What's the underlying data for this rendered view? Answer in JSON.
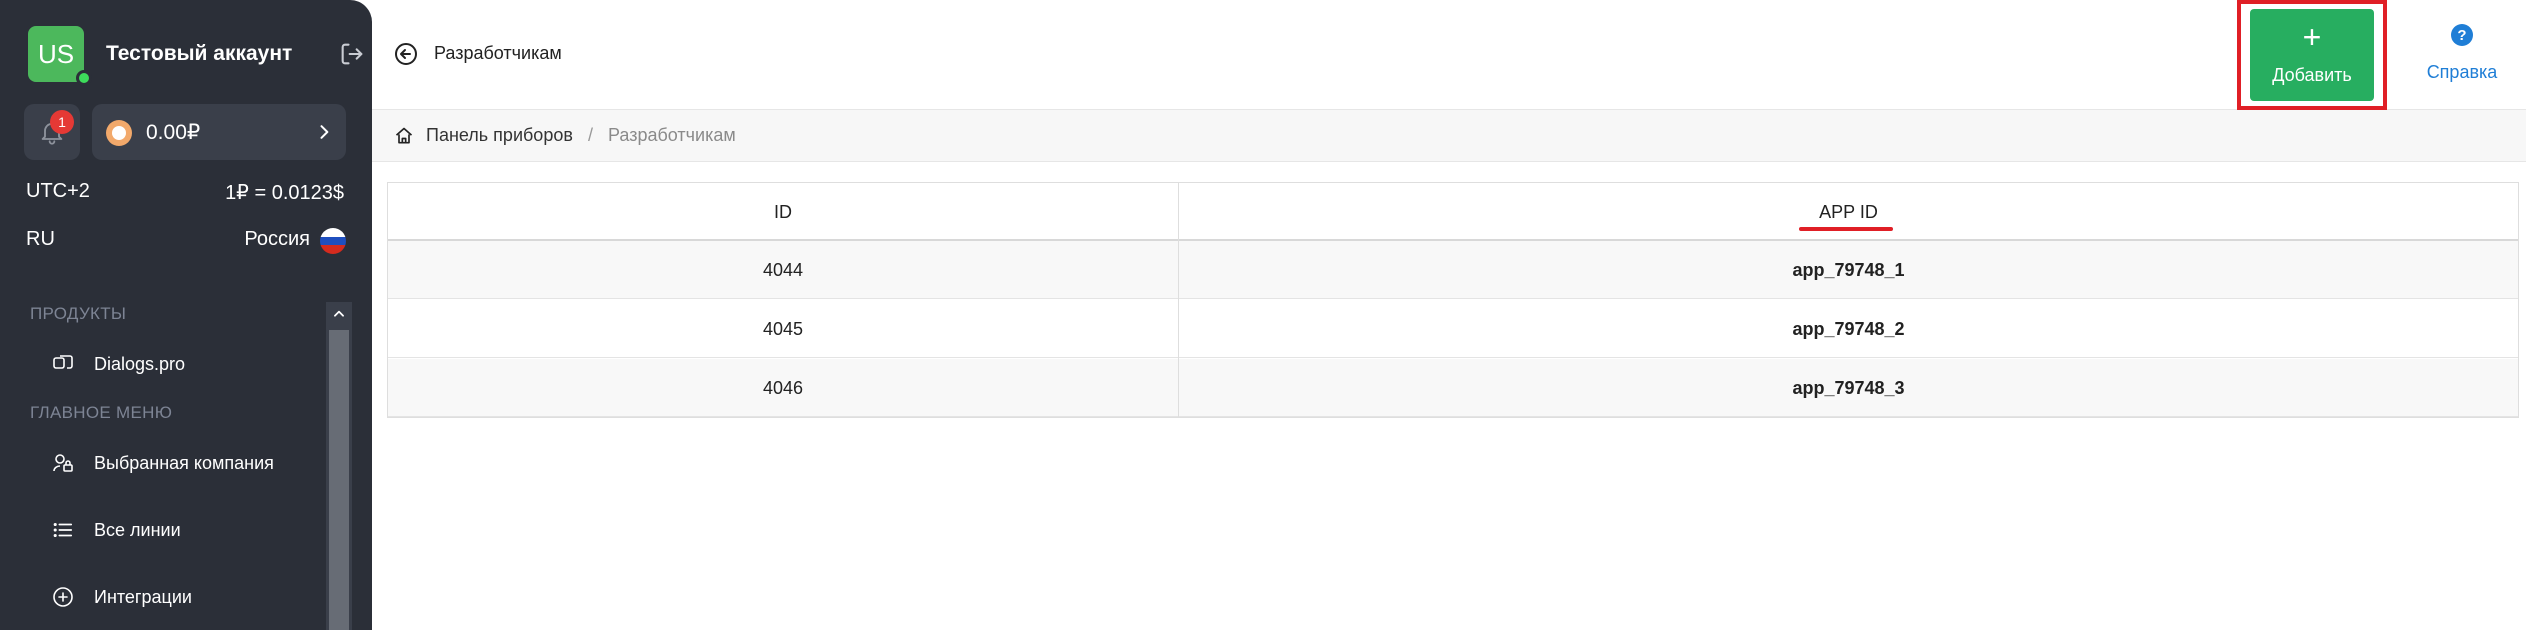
{
  "account": {
    "avatar_initials": "US",
    "name": "Тестовый аккаунт"
  },
  "notifications": {
    "count": "1"
  },
  "balance": {
    "amount": "0.00₽"
  },
  "info": {
    "timezone": "UTC+2",
    "rate": "1₽ = 0.0123$",
    "lang": "RU",
    "country": "Россия"
  },
  "sidebar": {
    "sections": [
      {
        "title": "ПРОДУКТЫ",
        "items": [
          {
            "label": "Dialogs.pro",
            "icon": "dialogs-icon"
          }
        ]
      },
      {
        "title": "ГЛАВНОЕ МЕНЮ",
        "items": [
          {
            "label": "Выбранная компания",
            "icon": "company-lock-icon"
          },
          {
            "label": "Все линии",
            "icon": "list-icon"
          },
          {
            "label": "Интеграции",
            "icon": "plus-circle-icon"
          }
        ]
      }
    ]
  },
  "header": {
    "title": "Разработчикам",
    "add_button": {
      "plus": "+",
      "label": "Добавить"
    },
    "help": {
      "icon": "?",
      "label": "Справка"
    }
  },
  "breadcrumb": {
    "items": [
      "Панель приборов",
      "Разработчикам"
    ],
    "separator": "/"
  },
  "table": {
    "columns": [
      "ID",
      "APP ID"
    ],
    "rows": [
      [
        "4044",
        "app_79748_1"
      ],
      [
        "4045",
        "app_79748_2"
      ],
      [
        "4046",
        "app_79748_3"
      ]
    ]
  },
  "colors": {
    "sidebar_bg": "#2b2f38",
    "accent_green": "#27ae60",
    "highlight_red": "#e01f26",
    "link_blue": "#1f7ed6"
  }
}
